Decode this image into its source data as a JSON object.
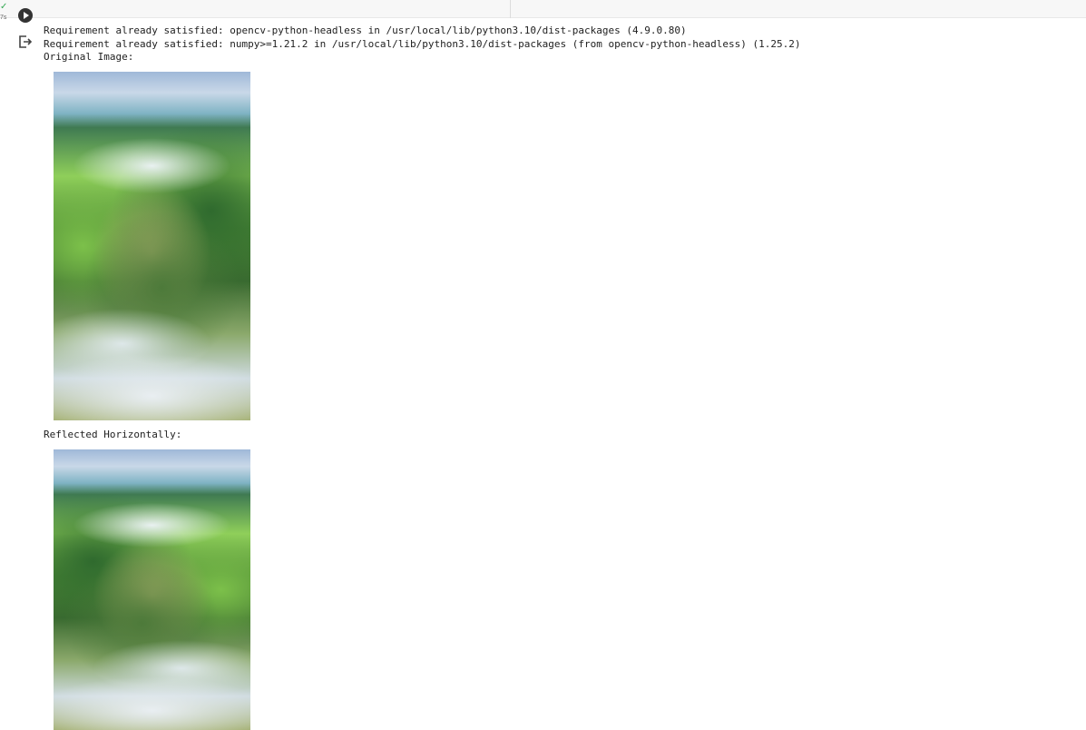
{
  "cell": {
    "status_time": "7s"
  },
  "output": {
    "lines": [
      "Requirement already satisfied: opencv-python-headless in /usr/local/lib/python3.10/dist-packages (4.9.0.80)",
      "Requirement already satisfied: numpy>=1.21.2 in /usr/local/lib/python3.10/dist-packages (from opencv-python-headless) (1.25.2)",
      "Original Image:"
    ],
    "reflected_label": "Reflected Horizontally:"
  }
}
